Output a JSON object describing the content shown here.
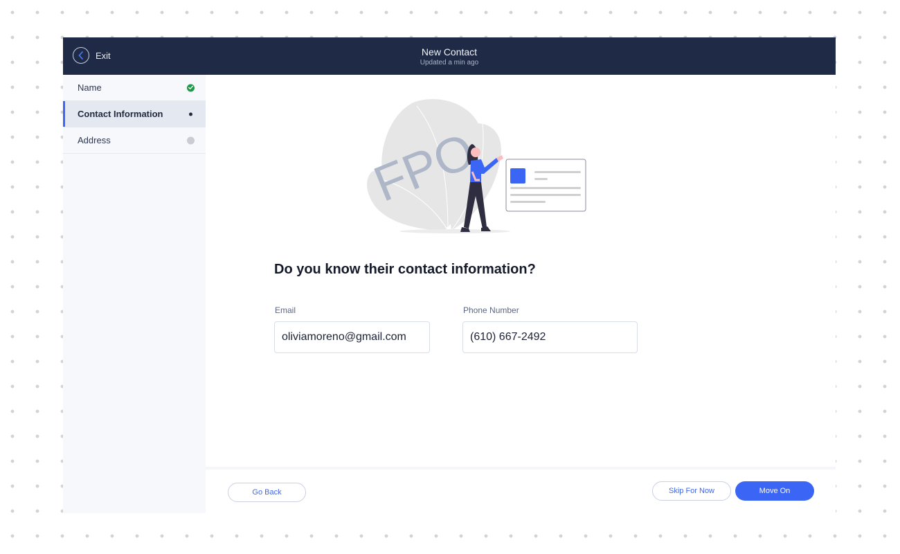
{
  "header": {
    "exit_label": "Exit",
    "title": "New Contact",
    "subtitle": "Updated a min ago"
  },
  "sidebar": {
    "steps": [
      {
        "label": "Name",
        "status": "complete"
      },
      {
        "label": "Contact Information",
        "status": "current"
      },
      {
        "label": "Address",
        "status": "pending"
      }
    ]
  },
  "illustration": {
    "watermark": "FPO"
  },
  "form": {
    "question": "Do you know their contact information?",
    "email_label": "Email",
    "email_value": "oliviamoreno@gmail.com",
    "phone_label": "Phone Number",
    "phone_value": "(610) 667-2492"
  },
  "footer": {
    "back_label": "Go Back",
    "skip_label": "Skip For Now",
    "next_label": "Move On"
  },
  "colors": {
    "header_bg": "#1f2b46",
    "accent": "#3b66f5",
    "success": "#1f9a4a"
  }
}
